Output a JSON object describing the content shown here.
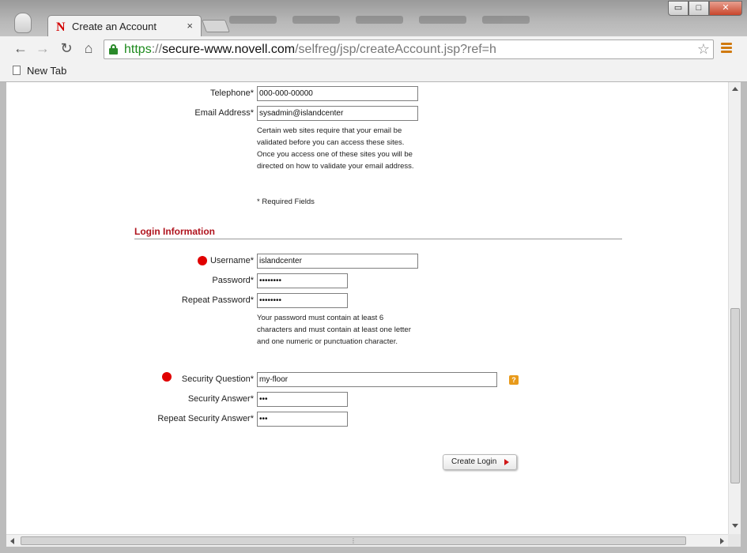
{
  "browser": {
    "tab_title": "Create an Account",
    "tab_favicon": "N",
    "tab_close": "×",
    "url_scheme": "https",
    "url_sep": "://",
    "url_host": "secure-www.novell.com",
    "url_path": "/selfreg/jsp/createAccount.jsp?ref=h",
    "bookmark_label": "New Tab",
    "window_buttons": {
      "minimize": "▭",
      "maximize": "□",
      "close": "✕"
    }
  },
  "form": {
    "telephone": {
      "label": "Telephone*",
      "value": "000-000-00000"
    },
    "email": {
      "label": "Email Address*",
      "value": "sysadmin@islandcenter"
    },
    "email_note": "Certain web sites require that your email be validated before you can access these sites. Once you access one of these sites you will be directed on how to validate your email address.",
    "required_note": "* Required Fields",
    "login_section_title": "Login Information",
    "username": {
      "label": "Username*",
      "value": "islandcenter"
    },
    "password": {
      "label": "Password*",
      "value": "••••••••"
    },
    "repeat_password": {
      "label": "Repeat Password*",
      "value": "••••••••"
    },
    "password_note": "Your password must contain at least 6 characters and must contain at least one letter and one numeric or punctuation character.",
    "security_question": {
      "label": "Security Question*",
      "value": "my-floor"
    },
    "security_answer": {
      "label": "Security Answer*",
      "value": "•••"
    },
    "repeat_security_answer": {
      "label": "Repeat Security Answer*",
      "value": "•••"
    },
    "help_icon_text": "?",
    "submit_label": "Create Login"
  },
  "colors": {
    "section_title": "#b0141e",
    "marker_dot": "#e00000",
    "secure_scheme": "#1e8b1e"
  }
}
